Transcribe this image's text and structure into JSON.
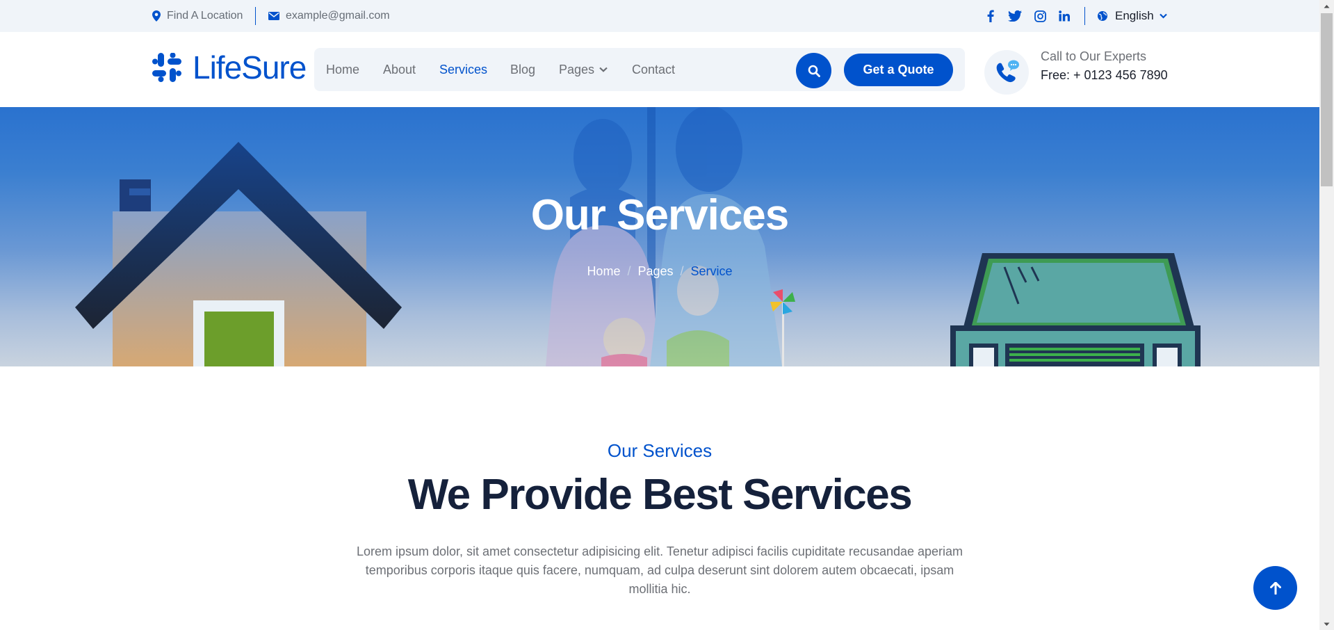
{
  "topbar": {
    "location_text": "Find A Location",
    "email_text": "example@gmail.com",
    "social_icons": [
      "facebook-icon",
      "twitter-icon",
      "instagram-icon",
      "linkedin-icon"
    ],
    "language": "English"
  },
  "header": {
    "logo_text": "LifeSure",
    "nav": [
      {
        "label": "Home"
      },
      {
        "label": "About"
      },
      {
        "label": "Services",
        "active": true
      },
      {
        "label": "Blog"
      },
      {
        "label": "Pages",
        "dropdown": true
      },
      {
        "label": "Contact"
      }
    ],
    "quote_button": "Get a Quote",
    "call_label": "Call to Our Experts",
    "call_number": "Free: + 0123 456 7890"
  },
  "hero": {
    "title": "Our Services",
    "breadcrumb": [
      "Home",
      "Pages",
      "Service"
    ],
    "breadcrumb_separator": "/"
  },
  "section": {
    "subtitle": "Our Services",
    "title": "We Provide Best Services",
    "text": "Lorem ipsum dolor, sit amet consectetur adipisicing elit. Tenetur adipisci facilis cupiditate recusandae aperiam temporibus corporis itaque quis facere, numquam, ad culpa deserunt sint dolorem autem obcaecati, ipsam mollitia hic."
  },
  "colors": {
    "primary": "#0052cc",
    "dark": "#15213b",
    "light_bg": "#f0f4f9"
  }
}
